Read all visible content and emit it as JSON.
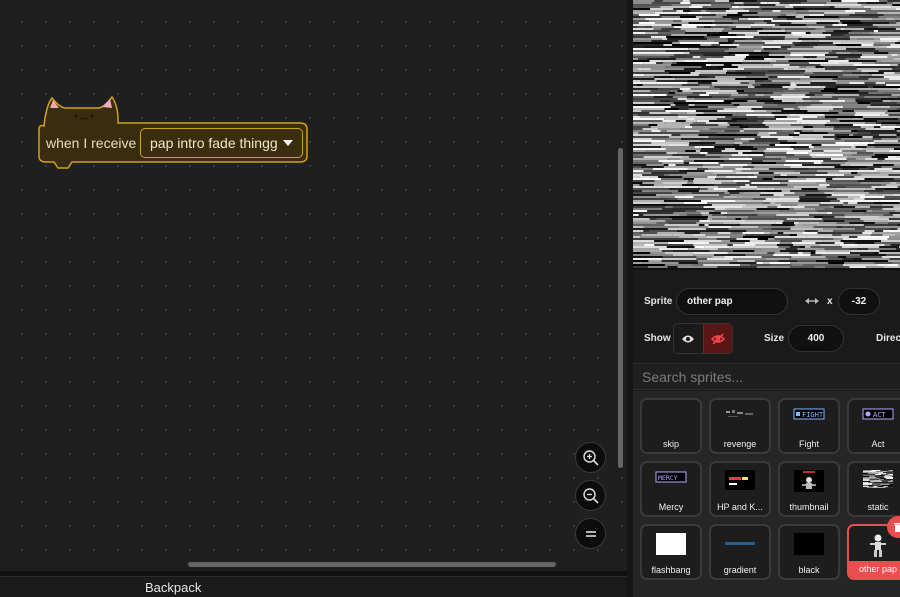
{
  "workspace": {
    "hat_block": {
      "label": "when I receive",
      "message": "pap intro fade thingg",
      "color": "#cfa21a"
    },
    "zoom_controls": [
      "zoom-in-icon",
      "zoom-out-icon",
      "zoom-reset-icon"
    ]
  },
  "backpack": {
    "label": "Backpack"
  },
  "sprite_info": {
    "sprite_label": "Sprite",
    "sprite_name": "other pap",
    "x_label": "x",
    "x_value": "-32",
    "show_label": "Show",
    "size_label": "Size",
    "size_value": "400",
    "direction_label": "Directi"
  },
  "search": {
    "placeholder": "Search sprites..."
  },
  "sprites": [
    {
      "name": "skip"
    },
    {
      "name": "revenge"
    },
    {
      "name": "Fight"
    },
    {
      "name": "Act"
    },
    {
      "name": "Mercy"
    },
    {
      "name": "HP and K..."
    },
    {
      "name": "thumbnail"
    },
    {
      "name": "static"
    },
    {
      "name": "flashbang"
    },
    {
      "name": "gradient"
    },
    {
      "name": "black"
    },
    {
      "name": "other pap",
      "selected": true
    }
  ],
  "thumb_text": {
    "fight": "FIGHT",
    "act": "ACT",
    "mercy": "MERCY"
  },
  "colors": {
    "accent_selected": "#e94f4f",
    "event_block": "#cfa21a",
    "workspace_bg": "#1f1f1f"
  }
}
